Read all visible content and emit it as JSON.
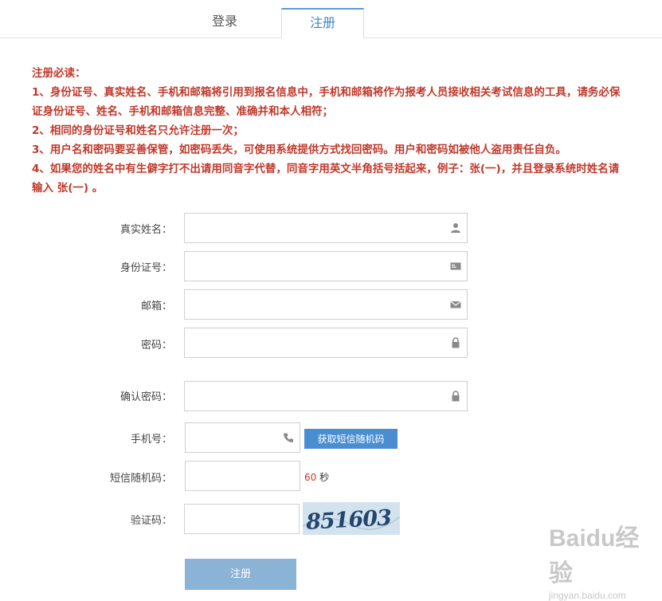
{
  "tabs": {
    "login": "登录",
    "register": "注册"
  },
  "notice": {
    "title": "注册必读：",
    "items": [
      "1、身份证号、真实姓名、手机和邮箱将引用到报名信息中，手机和邮箱将作为报考人员接收相关考试信息的工具，请务必保证身份证号、姓名、手机和邮箱信息完整、准确并和本人相符；",
      "2、相同的身份证号和姓名只允许注册一次；",
      "3、用户名和密码要妥善保管，如密码丢失，可使用系统提供方式找回密码。用户和密码如被他人盗用责任自负。",
      "4、如果您的姓名中有生僻字打不出请用同音字代替，同音字用英文半角括号括起来，例子：张(一)，并且登录系统时姓名请输入 张(一) 。"
    ]
  },
  "form": {
    "name_label": "真实姓名：",
    "id_label": "身份证号：",
    "email_label": "邮箱：",
    "password_label": "密码：",
    "confirm_label": "确认密码：",
    "phone_label": "手机号：",
    "sms_label": "短信随机码：",
    "captcha_label": "验证码：",
    "sms_button": "获取短信随机码",
    "countdown_value": "60",
    "countdown_unit": "秒",
    "captcha_text": "851603",
    "submit": "注册"
  },
  "icons": {
    "name": "user-icon",
    "id": "id-card-icon",
    "email": "envelope-icon",
    "password": "lock-icon",
    "confirm": "lock-icon",
    "phone": "phone-icon"
  },
  "colors": {
    "accent": "#4a8dd0",
    "notice": "#c0392b",
    "submit": "#8bb3d6"
  },
  "watermark": {
    "logo": "Baidu经验",
    "url": "jingyan.baidu.com"
  }
}
